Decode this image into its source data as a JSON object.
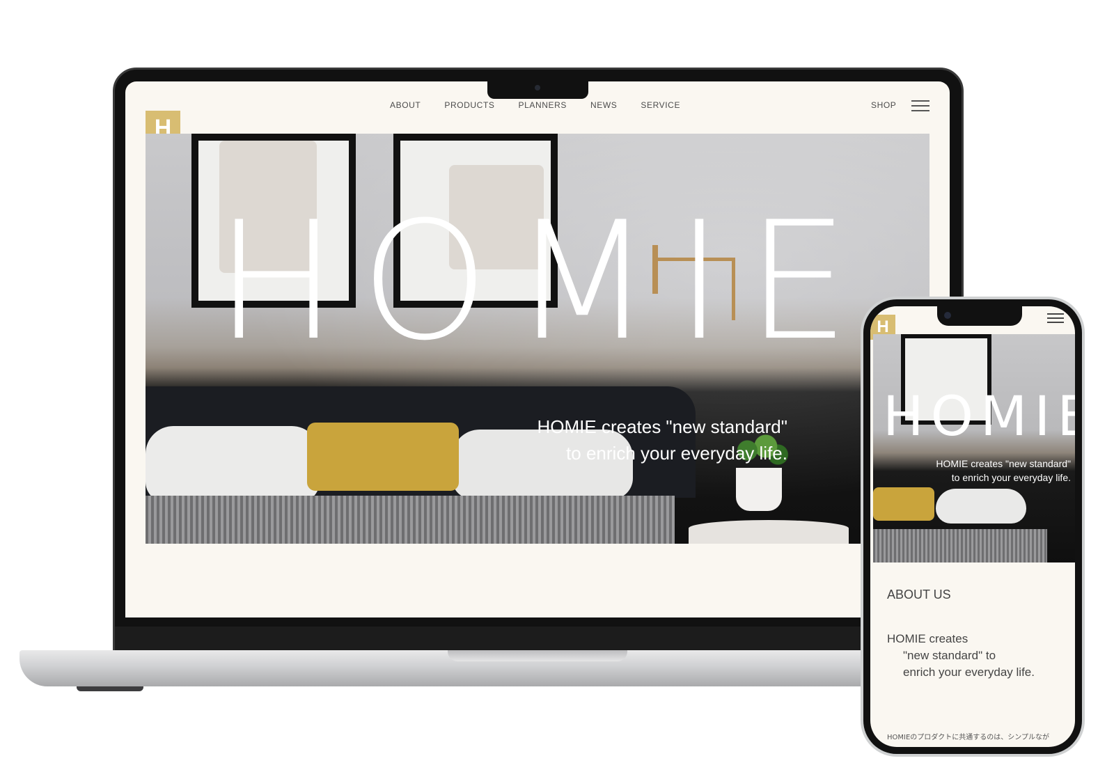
{
  "desktop": {
    "logo": "H",
    "nav": [
      "ABOUT",
      "PRODUCTS",
      "PLANNERS",
      "NEWS",
      "SERVICE"
    ],
    "shop": "SHOP",
    "hero": {
      "title": "HOMIE",
      "tagline_line1": "HOMIE creates \"new standard\"",
      "tagline_line2": "to enrich your everyday life."
    }
  },
  "mobile": {
    "logo": "H",
    "hero": {
      "title": "HOMIE",
      "tagline_line1": "HOMIE creates \"new standard\"",
      "tagline_line2": "to enrich your everyday life."
    },
    "about": {
      "title": "ABOUT US",
      "line1": "HOMIE creates",
      "line2": "\"new standard\" to",
      "line3": "enrich your everyday life.",
      "body_jp": "HOMIEのプロダクトに共通するのは、シンプルなが"
    }
  },
  "colors": {
    "accent": "#d8bd72",
    "page_bg": "#faf7f1"
  }
}
